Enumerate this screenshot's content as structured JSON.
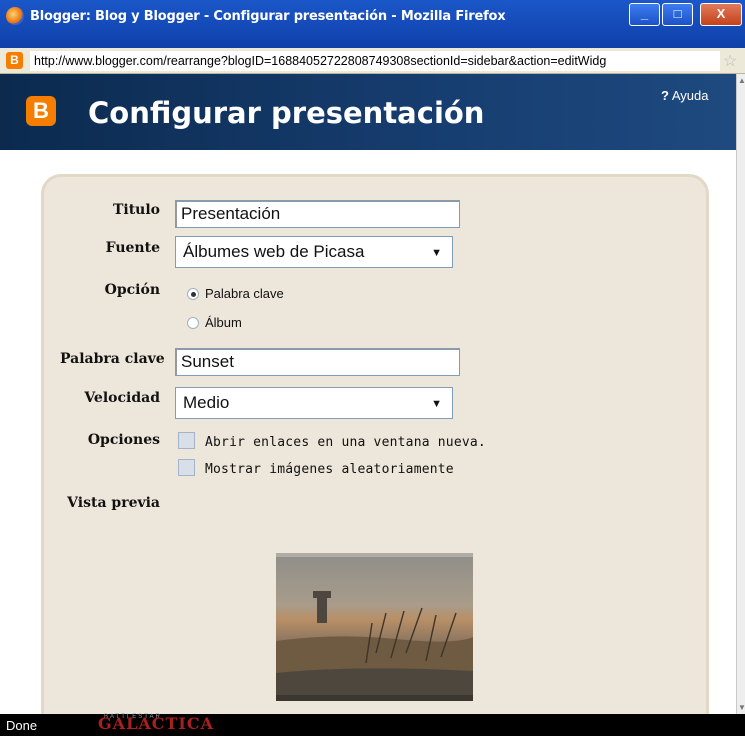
{
  "window": {
    "title": "Blogger: Blog y Blogger - Configurar presentación - Mozilla Firefox",
    "min_label": "_",
    "max_label": "□",
    "close_label": "X"
  },
  "addressbar": {
    "url": "http://www.blogger.com/rearrange?blogID=16884052722808749308sectionId=sidebar&action=editWidg",
    "favicon_letter": "B"
  },
  "header": {
    "logo_letter": "B",
    "title": "Configurar presentación",
    "help_mark": "?",
    "help_label": "Ayuda"
  },
  "form": {
    "titulo_label": "Titulo",
    "titulo_value": "Presentación",
    "fuente_label": "Fuente",
    "fuente_value": "Álbumes web de Picasa",
    "opcion_label": "Opción",
    "opcion_options": [
      "Palabra clave",
      "Álbum"
    ],
    "opcion_selected": "Palabra clave",
    "palabra_label": "Palabra clave",
    "palabra_value": "Sunset",
    "velocidad_label": "Velocidad",
    "velocidad_value": "Medio",
    "opciones_label": "Opciones",
    "check_enlaces": "Abrir enlaces en una ventana nueva.",
    "check_aleatorio": "Mostrar imágenes aleatoriamente",
    "vista_label": "Vista previa"
  },
  "statusbar": {
    "status": "Done",
    "tag_small": "BATTLESTAR",
    "tag_big": "GALACTICA"
  },
  "colors": {
    "header_bg": "#163c6e",
    "panel_bg": "#ede6db",
    "blogger_orange": "#f57d00"
  }
}
